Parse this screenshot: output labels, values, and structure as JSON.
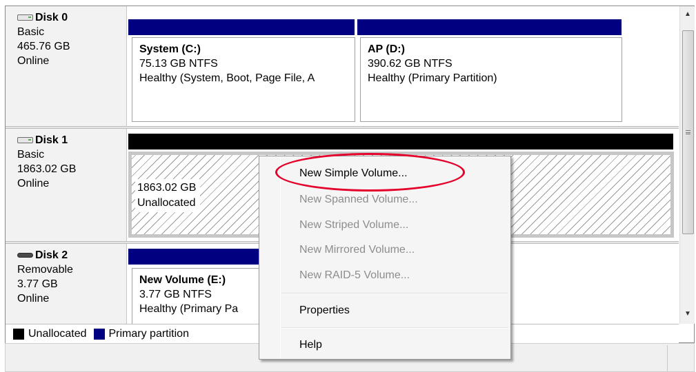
{
  "disks": [
    {
      "name": "Disk 0",
      "type": "Basic",
      "size": "465.76 GB",
      "status": "Online",
      "partitions": [
        {
          "name": "System  (C:)",
          "size_fs": "75.13 GB NTFS",
          "status": "Healthy (System, Boot, Page File, A"
        },
        {
          "name": "AP  (D:)",
          "size_fs": "390.62 GB NTFS",
          "status": "Healthy (Primary Partition)"
        }
      ]
    },
    {
      "name": "Disk 1",
      "type": "Basic",
      "size": "1863.02 GB",
      "status": "Online",
      "unallocated": {
        "size": "1863.02 GB",
        "label": "Unallocated"
      }
    },
    {
      "name": "Disk 2",
      "type": "Removable",
      "size": "3.77 GB",
      "status": "Online",
      "partitions": [
        {
          "name": "New Volume  (E:)",
          "size_fs": "3.77 GB NTFS",
          "status": "Healthy (Primary Pa"
        }
      ]
    }
  ],
  "legend": [
    {
      "label": "Unallocated",
      "color": "#000000"
    },
    {
      "label": "Primary partition",
      "color": "#000080"
    }
  ],
  "context_menu": {
    "items": [
      {
        "label": "New Simple Volume...",
        "enabled": true
      },
      {
        "label": "New Spanned Volume...",
        "enabled": false
      },
      {
        "label": "New Striped Volume...",
        "enabled": false
      },
      {
        "label": "New Mirrored Volume...",
        "enabled": false
      },
      {
        "label": "New RAID-5 Volume...",
        "enabled": false
      },
      {
        "label": "Properties",
        "enabled": true
      },
      {
        "label": "Help",
        "enabled": true
      }
    ]
  },
  "colors": {
    "primary_partition": "#000080",
    "unallocated": "#000000",
    "highlight_annotation": "#e4002b"
  }
}
